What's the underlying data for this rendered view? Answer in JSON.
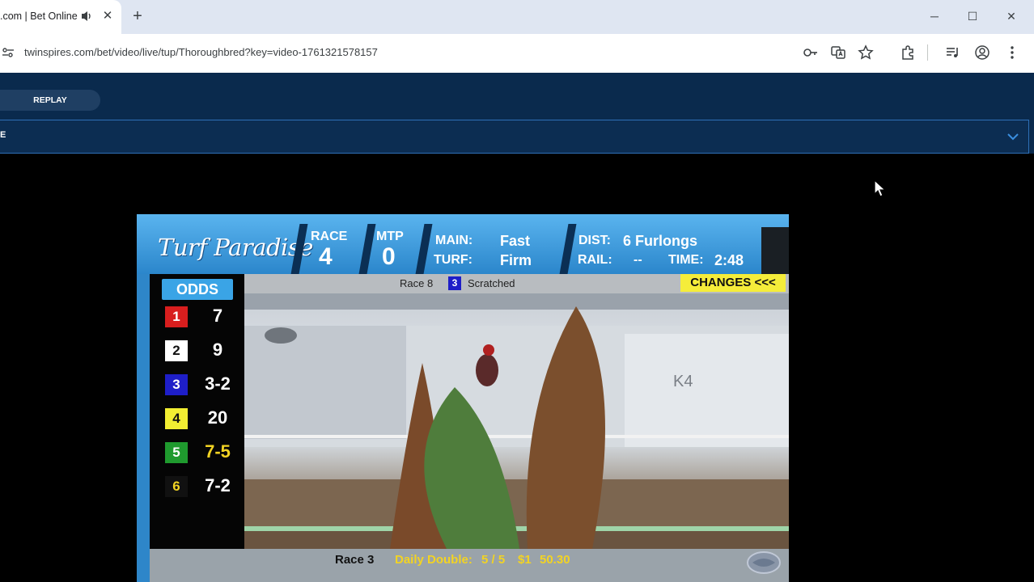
{
  "browser": {
    "tab_title": ".com | Bet Online",
    "tab_close": "✕",
    "new_tab": "+",
    "url": "twinspires.com/bet/video/live/tup/Thoroughbred?key=video-1761321578157",
    "win_min": "─",
    "win_max": "☐",
    "win_close": "✕"
  },
  "header": {
    "replay_label": "REPLAY",
    "selector_text": "E"
  },
  "video": {
    "track_name": "Turf Paradise",
    "race_label": "RACE",
    "race_number": "4",
    "mtp_label": "MTP",
    "mtp_value": "0",
    "main_label": "MAIN:",
    "main_value": "Fast",
    "turf_label": "TURF:",
    "turf_value": "Firm",
    "dist_label": "DIST:",
    "dist_value": "6 Furlongs",
    "rail_label": "RAIL:",
    "rail_value": "--",
    "time_label": "TIME:",
    "time_value": "2:48",
    "odds_header": "ODDS",
    "odds": [
      {
        "pp": "1",
        "odds": "7",
        "bg": "#d81e1e",
        "fg": "#ffffff",
        "odds_color": "#ffffff"
      },
      {
        "pp": "2",
        "odds": "9",
        "bg": "#ffffff",
        "fg": "#111111",
        "odds_color": "#ffffff"
      },
      {
        "pp": "3",
        "odds": "3-2",
        "bg": "#1e1ec8",
        "fg": "#ffffff",
        "odds_color": "#ffffff"
      },
      {
        "pp": "4",
        "odds": "20",
        "bg": "#f2ee32",
        "fg": "#111111",
        "odds_color": "#ffffff"
      },
      {
        "pp": "5",
        "odds": "7-5",
        "bg": "#1f9a2e",
        "fg": "#ffffff",
        "odds_color": "#f2d323"
      },
      {
        "pp": "6",
        "odds": "7-2",
        "bg": "#111111",
        "fg": "#f2d323",
        "odds_color": "#ffffff"
      }
    ],
    "scratch_race": "Race 8",
    "scratch_pp": "3",
    "scratch_text": "Scratched",
    "changes_label": "CHANGES <<<",
    "bottom_race": "Race 3",
    "daily_double_label": "Daily Double:",
    "daily_double_value": "5 / 5",
    "bet_amount": "$1",
    "payout": "50.30"
  }
}
